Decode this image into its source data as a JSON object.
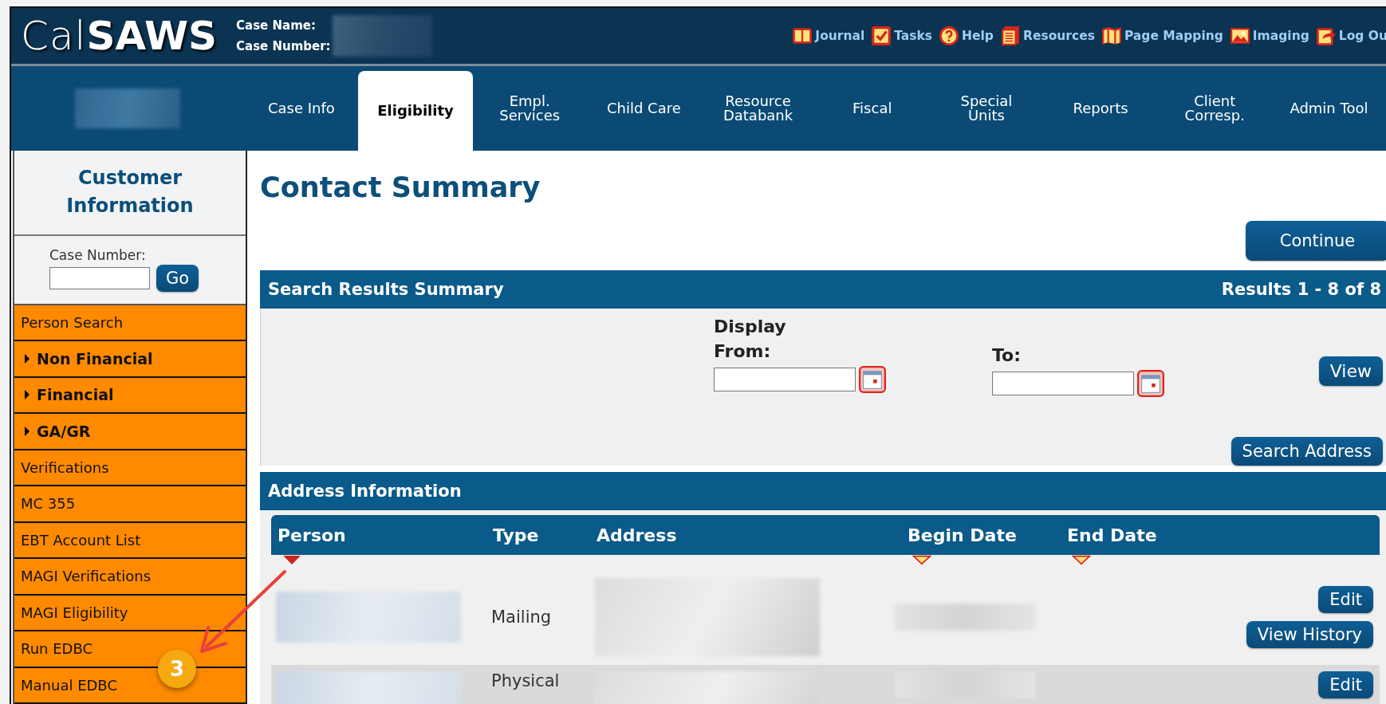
{
  "header": {
    "logo_light": "Cal",
    "logo_bold": "SAWS",
    "case_name_label": "Case Name:",
    "case_number_label": "Case Number:"
  },
  "toolbar": [
    {
      "label": "Journal"
    },
    {
      "label": "Tasks"
    },
    {
      "label": "Help"
    },
    {
      "label": "Resources"
    },
    {
      "label": "Page Mapping"
    },
    {
      "label": "Imaging"
    },
    {
      "label": "Log Ou"
    }
  ],
  "nav_tabs": [
    {
      "label": "Case Info",
      "selected": false
    },
    {
      "label": "Eligibility",
      "selected": true
    },
    {
      "label": "Empl.\nServices",
      "selected": false
    },
    {
      "label": "Child Care",
      "selected": false
    },
    {
      "label": "Resource\nDatabank",
      "selected": false
    },
    {
      "label": "Fiscal",
      "selected": false
    },
    {
      "label": "Special\nUnits",
      "selected": false
    },
    {
      "label": "Reports",
      "selected": false
    },
    {
      "label": "Client\nCorresp.",
      "selected": false
    },
    {
      "label": "Admin Tool",
      "selected": false
    }
  ],
  "sidebar": {
    "title": "Customer Information",
    "case_number_label": "Case Number:",
    "go_button": "Go",
    "items": [
      {
        "label": "Person Search",
        "kind": "link"
      },
      {
        "label": "Non Financial",
        "kind": "group",
        "expanded": false
      },
      {
        "label": "Financial",
        "kind": "group",
        "expanded": false
      },
      {
        "label": "GA/GR",
        "kind": "group",
        "expanded": false
      },
      {
        "label": "Verifications",
        "kind": "link"
      },
      {
        "label": "MC 355",
        "kind": "link"
      },
      {
        "label": "EBT Account List",
        "kind": "link"
      },
      {
        "label": "MAGI Verifications",
        "kind": "link"
      },
      {
        "label": "MAGI Eligibility",
        "kind": "link"
      },
      {
        "label": "Run EDBC",
        "kind": "link"
      },
      {
        "label": "Manual EDBC",
        "kind": "link"
      }
    ]
  },
  "page": {
    "title": "Contact Summary",
    "continue_button": "Continue"
  },
  "search_results": {
    "title": "Search Results Summary",
    "results": "Results 1 - 8 of 8",
    "display_label": "Display",
    "from_label": "From:",
    "to_label": "To:",
    "view_button": "View",
    "search_address_button": "Search Address"
  },
  "address_info": {
    "title": "Address Information",
    "columns": [
      {
        "label": "Person",
        "sorted": true
      },
      {
        "label": "Type"
      },
      {
        "label": "Address"
      },
      {
        "label": "Begin Date",
        "sorted": false
      },
      {
        "label": "End Date",
        "sorted": false
      }
    ],
    "rows": [
      {
        "type": "Mailing",
        "buttons": [
          "Edit",
          "View History"
        ]
      },
      {
        "type": "Physical",
        "buttons": [
          "Edit"
        ]
      }
    ]
  },
  "annotation": {
    "step": "3"
  }
}
